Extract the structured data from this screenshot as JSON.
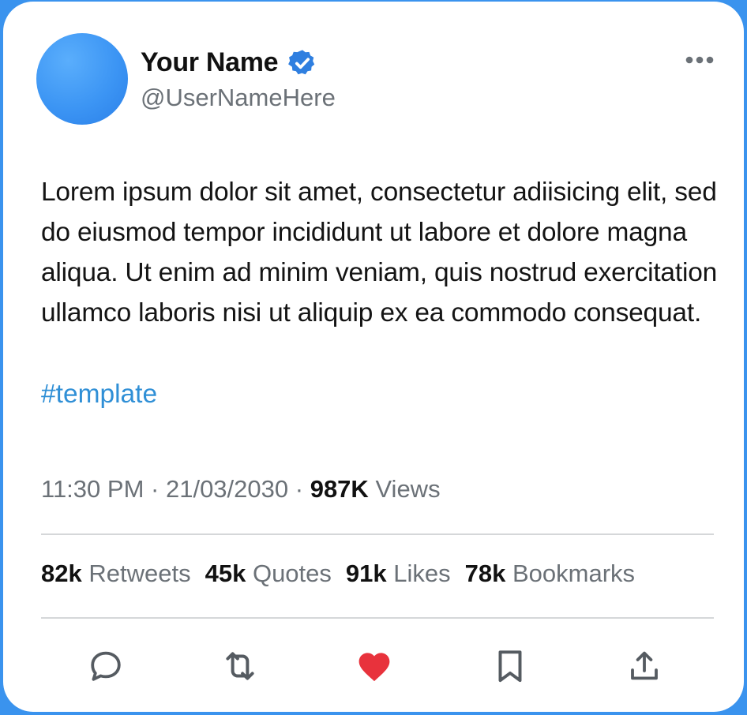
{
  "user": {
    "display_name": "Your Name",
    "handle": "@UserNameHere",
    "verified": true
  },
  "tweet": {
    "text": "Lorem ipsum dolor sit amet, consectetur adiisicing elit, sed do eiusmod tempor incididunt ut labore et dolore magna aliqua. Ut enim ad minim veniam, quis nostrud exercitation ullamco laboris nisi ut aliquip ex ea commodo consequat.",
    "hashtag": "#template",
    "time": "11:30 PM",
    "separator": "·",
    "date": "21/03/2030",
    "views_count": "987K",
    "views_label": "Views"
  },
  "stats": [
    {
      "count": "82k",
      "label": "Retweets"
    },
    {
      "count": "45k",
      "label": "Quotes"
    },
    {
      "count": "91k",
      "label": "Likes"
    },
    {
      "count": "78k",
      "label": "Bookmarks"
    }
  ],
  "actions": [
    {
      "icon": "reply-icon"
    },
    {
      "icon": "retweet-icon"
    },
    {
      "icon": "heart-icon",
      "active": true
    },
    {
      "icon": "bookmark-icon"
    },
    {
      "icon": "share-icon"
    }
  ],
  "colors": {
    "background": "#3a93ee",
    "avatar": "#3c95f4",
    "verified": "#2f7fe0",
    "hashtag": "#2f8fd6",
    "heart": "#e8323c",
    "muted_text": "#6b7177"
  }
}
